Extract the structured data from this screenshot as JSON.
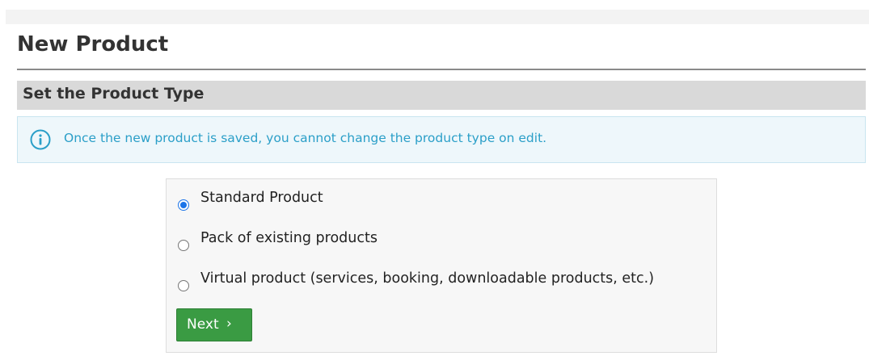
{
  "page": {
    "title": "New Product"
  },
  "section": {
    "title": "Set the Product Type"
  },
  "notice": {
    "icon": "info-icon",
    "text": "Once the new product is saved, you cannot change the product type on edit.",
    "color": "#2b9fc8"
  },
  "product_types": {
    "selected": "Standard Product",
    "options": [
      {
        "label": "Standard Product",
        "checked": true
      },
      {
        "label": "Pack of existing products",
        "checked": false
      },
      {
        "label": "Virtual product (services, booking, downloadable products, etc.)",
        "checked": false
      }
    ]
  },
  "actions": {
    "next_label": "Next",
    "next_icon": "chevron-right-icon",
    "next_glyph": "›",
    "next_color": "#3a9b43"
  }
}
